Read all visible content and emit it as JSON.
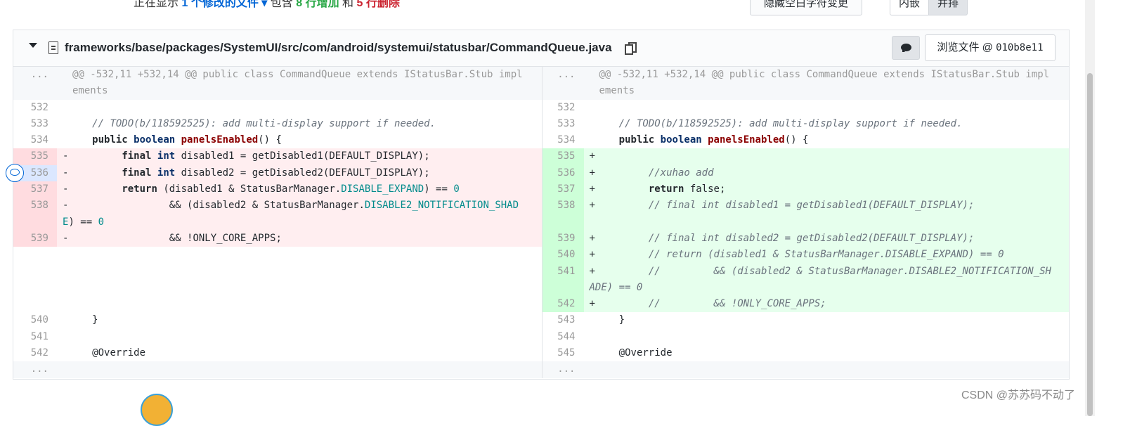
{
  "summary": {
    "prefix": "正在显示",
    "files": "1 个修改的文件",
    "mid": "包含",
    "additions": "8 行增加",
    "and": "和",
    "deletions": "5 行删除"
  },
  "toolbar": {
    "whitespace_button": "隐藏空白字符变更",
    "inline_label": "内嵌",
    "split_label": "并排"
  },
  "file": {
    "path": "frameworks/base/packages/SystemUI/src/com/android/systemui/statusbar/CommandQueue.java",
    "browse_label": "浏览文件 @",
    "commit": "010b8e11"
  },
  "diff": {
    "hunk_header": "@@ -532,11 +532,14 @@ public class CommandQueue extends IStatusBar.Stub implements",
    "ellipsis": "...",
    "rows": [
      {
        "type": "context",
        "lnum": "532",
        "rnum": "532",
        "ltext": "",
        "rtext": ""
      },
      {
        "type": "context",
        "lnum": "533",
        "rnum": "533",
        "ltext": "    // TODO(b/118592525): add multi-display support if needed.",
        "rtext": "    // TODO(b/118592525): add multi-display support if needed."
      },
      {
        "type": "context",
        "lnum": "534",
        "rnum": "534",
        "ltext": "    public boolean panelsEnabled() {",
        "rtext": "    public boolean panelsEnabled() {"
      },
      {
        "type": "change",
        "lnum": "535",
        "rnum": "535",
        "lsign": "-",
        "rsign": "+",
        "ltext": "        final int disabled1 = getDisabled1(DEFAULT_DISPLAY);",
        "rtext": ""
      },
      {
        "type": "change",
        "lnum": "536",
        "rnum": "536",
        "lsign": "-",
        "rsign": "+",
        "ltext": "        final int disabled2 = getDisabled2(DEFAULT_DISPLAY);",
        "rtext": "        //xuhao add"
      },
      {
        "type": "change",
        "lnum": "537",
        "rnum": "537",
        "lsign": "-",
        "rsign": "+",
        "ltext": "        return (disabled1 & StatusBarManager.DISABLE_EXPAND) == 0",
        "rtext": "        return false;"
      },
      {
        "type": "change",
        "lnum": "538",
        "rnum": "538",
        "lsign": "-",
        "rsign": "+",
        "ltext": "                && (disabled2 & StatusBarManager.DISABLE2_NOTIFICATION_SHADE) == 0",
        "rtext": "        // final int disabled1 = getDisabled1(DEFAULT_DISPLAY);"
      },
      {
        "type": "change",
        "lnum": "539",
        "rnum": "539",
        "lsign": "-",
        "rsign": "+",
        "ltext": "                && !ONLY_CORE_APPS;",
        "rtext": "        // final int disabled2 = getDisabled2(DEFAULT_DISPLAY);"
      },
      {
        "type": "addonly",
        "lnum": "",
        "rnum": "540",
        "lsign": "",
        "rsign": "+",
        "ltext": "",
        "rtext": "        // return (disabled1 & StatusBarManager.DISABLE_EXPAND) == 0"
      },
      {
        "type": "addonly",
        "lnum": "",
        "rnum": "541",
        "lsign": "",
        "rsign": "+",
        "ltext": "",
        "rtext": "        //         && (disabled2 & StatusBarManager.DISABLE2_NOTIFICATION_SHADE) == 0"
      },
      {
        "type": "addonly",
        "lnum": "",
        "rnum": "542",
        "lsign": "",
        "rsign": "+",
        "ltext": "",
        "rtext": "        //         && !ONLY_CORE_APPS;"
      },
      {
        "type": "context",
        "lnum": "540",
        "rnum": "543",
        "ltext": "    }",
        "rtext": "    }"
      },
      {
        "type": "context",
        "lnum": "541",
        "rnum": "544",
        "ltext": "",
        "rtext": ""
      },
      {
        "type": "context",
        "lnum": "542",
        "rnum": "545",
        "ltext": "    @Override",
        "rtext": "    @Override"
      }
    ]
  },
  "watermark": "CSDN @苏苏码不动了",
  "colors": {
    "deleted_bg": "#ffeef0",
    "deleted_num_bg": "#ffdce0",
    "added_bg": "#e6ffed",
    "added_num_bg": "#cdffd8",
    "accent": "#0366d6"
  }
}
